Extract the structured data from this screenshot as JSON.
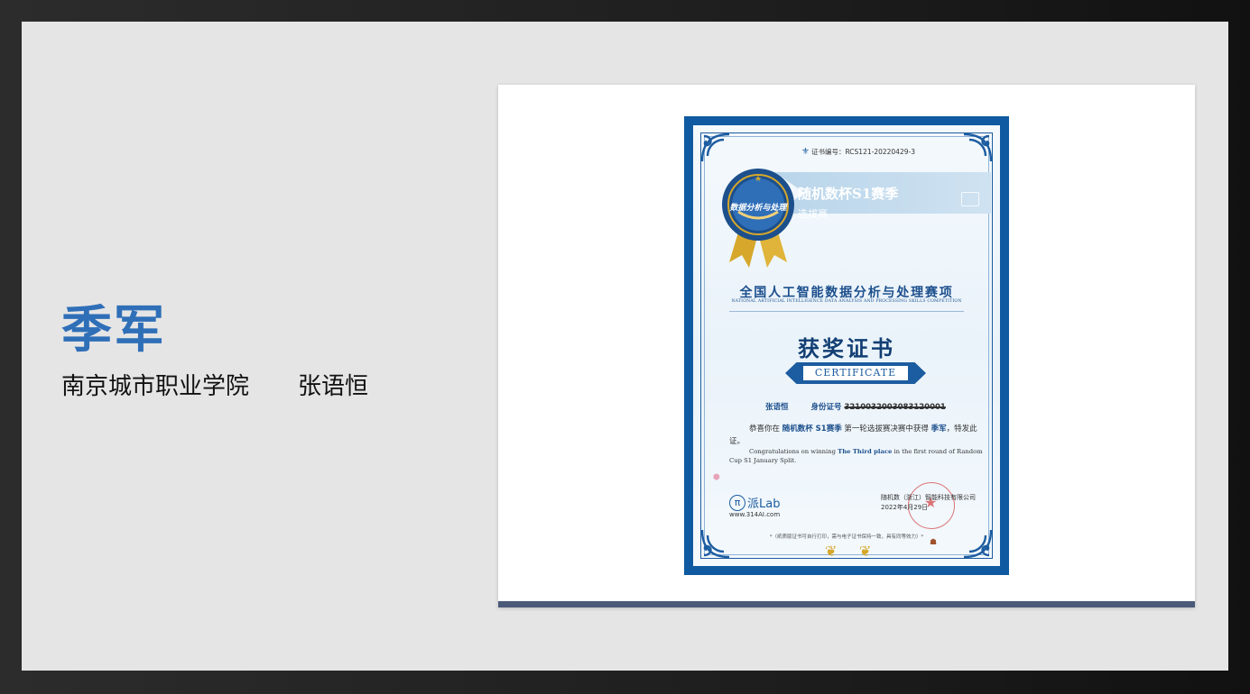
{
  "slide": {
    "award_title": "季军",
    "school": "南京城市职业学院",
    "student_name": "张语恒"
  },
  "certificate": {
    "cert_no": "证书编号：RCS121-20220429-3",
    "banner_title": "随机数杯S1赛季",
    "banner_subtitle": "选拔赛",
    "medal_label": "数据分析与处理",
    "competition_cn": "全国人工智能数据分析与处理赛项",
    "competition_en": "NATIONAL ARTIFICIAL INTELLIGENCE DATA ANALYSIS AND PROCESSING SKILLS COMPETITION",
    "heading": "获奖证书",
    "heading_en": "CERTIFICATE",
    "recipient_name": "张语恒",
    "id_label": "身份证号",
    "id_value": "3210032003083120001",
    "congrats_cn_1": "恭喜你在",
    "congrats_cn_hl1": "随机数杯 S1赛季",
    "congrats_cn_2": "第一轮选拔赛决赛中获得",
    "congrats_cn_hl2": "季军",
    "congrats_cn_3": "，特发此证。",
    "congrats_en_1": "Congratulations on winning",
    "congrats_en_hl": "The Third place",
    "congrats_en_2": "in the first round of Random Cup S1 January Split.",
    "logo_symbol": "π",
    "logo_text": "派Lab",
    "logo_url": "www.314AI.com",
    "issuer": "随机数（浙江）智能科技有限公司",
    "issue_date": "2022年4月29日",
    "footnote": "*（纸质版证书可自行打印，需与电子证书保持一致，具有同等效力）*"
  },
  "colors": {
    "accent": "#2f6fb8",
    "cert_blue": "#0f5aa0",
    "slide_bg": "#e5e5e5",
    "card_bar": "#4a5a78"
  }
}
